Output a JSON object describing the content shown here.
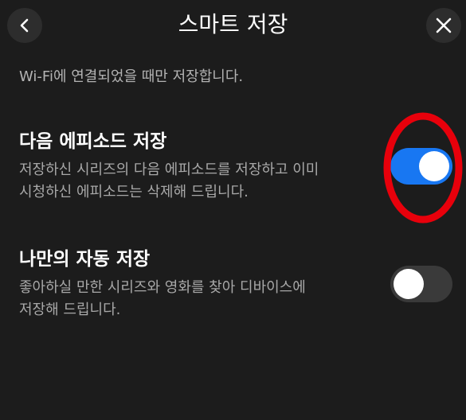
{
  "header": {
    "title": "스마트 저장",
    "back_icon": "chevron-left-icon",
    "close_icon": "close-icon",
    "button_bg": "#2d2d2d"
  },
  "wifi_note": "Wi-Fi에 연결되었을 때만 저장합니다.",
  "settings": [
    {
      "title": "다음 에피소드 저장",
      "desc_lines": [
        "저장하신 시리즈의 다음 에피소드를 저장하고 이미",
        "시청하신 에피소드는 삭제해 드립니다."
      ],
      "enabled": true
    },
    {
      "title": "나만의 자동 저장",
      "desc_lines": [
        "좋아하실 만한 시리즈와 영화를 찾아 디바이스에",
        "저장해 드립니다."
      ],
      "enabled": false
    }
  ],
  "colors": {
    "background": "#1c1c1c",
    "toggle_on": "#1877f2",
    "toggle_off": "#3a3a3a",
    "annotation": "#e8000b"
  }
}
